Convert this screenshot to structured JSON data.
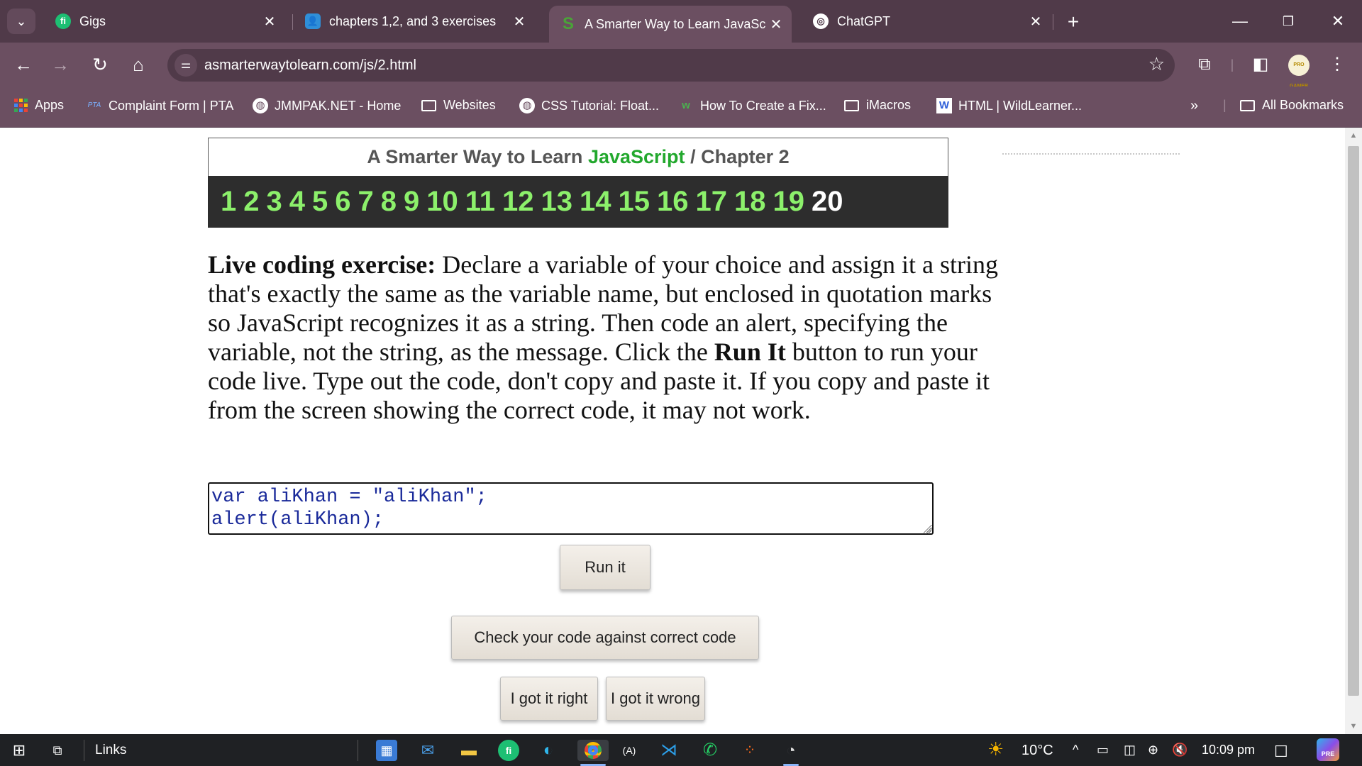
{
  "browser": {
    "tabs": [
      {
        "title": "Gigs",
        "favicon": "fi",
        "color": "#1dbf73"
      },
      {
        "title": "chapters 1,2, and 3 exercises",
        "favicon": "👤",
        "color": "#2f8fd8"
      },
      {
        "title": "A Smarter Way to Learn JavaScr",
        "favicon": "S",
        "color": "#4aa338",
        "active": true
      },
      {
        "title": "ChatGPT",
        "favicon": "◎",
        "color": "#ffffff"
      }
    ],
    "address": "asmarterwaytolearn.com/js/2.html",
    "bookmarks": [
      {
        "label": "Apps"
      },
      {
        "label": "Complaint Form | PTA"
      },
      {
        "label": "JMMPAK.NET - Home"
      },
      {
        "label": "Websites"
      },
      {
        "label": "CSS Tutorial: Float..."
      },
      {
        "label": "How To Create a Fix..."
      },
      {
        "label": "iMacros"
      },
      {
        "label": "HTML | WildLearner..."
      },
      {
        "label": "All Bookmarks"
      }
    ],
    "avatar_text": "PRO GAMER"
  },
  "page": {
    "header": {
      "prefix": "A Smarter Way to Learn",
      "brand": "JavaScript",
      "separator": "/",
      "chapter": "Chapter 2"
    },
    "chapters": [
      "1",
      "2",
      "3",
      "4",
      "5",
      "6",
      "7",
      "8",
      "9",
      "10",
      "11",
      "12",
      "13",
      "14",
      "15",
      "16",
      "17",
      "18",
      "19",
      "20"
    ],
    "current_chapter": "20",
    "exercise": {
      "lead": "Live coding exercise:",
      "text1": " Declare a variable of your choice and assign it a string that's exactly the same as the variable name, but enclosed in quotation marks so JavaScript recognizes it as a string. Then code an alert, specifying the variable, not the string, as the message. Click the ",
      "bold2": "Run It",
      "text2": " button to run your code live. Type out the code, don't copy and paste it. If you copy and paste it from the screen showing the correct code, it may not work."
    },
    "code": "var aliKhan = \"aliKhan\";\nalert(aliKhan);",
    "buttons": {
      "run": "Run it",
      "check": "Check your code against correct code",
      "right": "I got it right",
      "wrong": "I got it wrong"
    }
  },
  "taskbar": {
    "search_label": "Links",
    "weather": "10°C",
    "time": "10:09 pm"
  }
}
